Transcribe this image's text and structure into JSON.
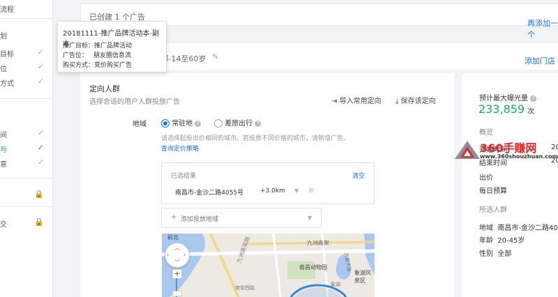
{
  "sidebar": {
    "items": [
      {
        "label": "流程",
        "icon": "none"
      },
      {
        "label": "划",
        "icon": "none"
      },
      {
        "label": "目标",
        "icon": "check-icon"
      },
      {
        "label": "位",
        "icon": "check-icon"
      },
      {
        "label": "方式",
        "icon": "check-icon"
      },
      {
        "label": "间",
        "icon": "check-icon"
      },
      {
        "label": "与",
        "icon": "check-icon"
      },
      {
        "label": "意",
        "icon": "check-icon"
      },
      {
        "label": "",
        "icon": "lock-icon"
      },
      {
        "label": "交",
        "icon": "lock-icon"
      }
    ]
  },
  "topcard": {
    "partial_text": "已创建 1 个广告",
    "add_more": "再添加一个"
  },
  "tooltip": {
    "title": "20181111-推广品牌活动本-副本",
    "rows": [
      {
        "k": "推广目标：",
        "v": "推广品牌活动"
      },
      {
        "k": "广告位：",
        "v": "朋友圈信息流"
      },
      {
        "k": "购买方式：",
        "v": "竞价购买广告"
      }
    ]
  },
  "section_header": {
    "summary": "其他 全部-14至60岁",
    "add_store": "添加门店"
  },
  "targeting": {
    "title": "定向人群",
    "subtitle": "选择合适的用户人群投放广告",
    "import_btn": "导入常用定向",
    "save_btn": "保存该定向",
    "region_label": "地域",
    "opt_resident": "常驻地",
    "opt_travel": "差旅出行",
    "hint": "请选择起投出价相同的城市。若投放不同价格的城市，请新增广告。",
    "pricing_link": "查询定价策略",
    "selected_title": "已选结果",
    "clear": "清空",
    "selected_item": "南昌市-金沙二路4055号",
    "radius": "+3.0km",
    "add_region": "添加投放地域"
  },
  "map": {
    "labels": [
      "前北",
      "九洲高架",
      "九洲高架路",
      "南昌动物园",
      "象湖风景区",
      "洪都大道",
      "象湖",
      "南京西路"
    ],
    "btn_map": "地图",
    "btn_sat": "卫星"
  },
  "right": {
    "exposure_title": "预计最大曝光量",
    "exposure_value": "233,859",
    "exposure_unit": "次",
    "overview": "概览",
    "rows": [
      {
        "k": "开始时间",
        "v": "20"
      },
      {
        "k": "结束时间",
        "v": "20"
      },
      {
        "k": "出价",
        "v": ""
      },
      {
        "k": "每日预算",
        "v": ""
      }
    ],
    "audience_title": "所选人群",
    "audience": [
      {
        "k": "地域",
        "v": "南昌市-金沙二路40"
      },
      {
        "k": "年龄",
        "v": "20-45岁"
      },
      {
        "k": "性别",
        "v": "全部"
      }
    ]
  },
  "watermark": {
    "brand": "360手赚网",
    "url": "www.360shouzhuan.com"
  }
}
